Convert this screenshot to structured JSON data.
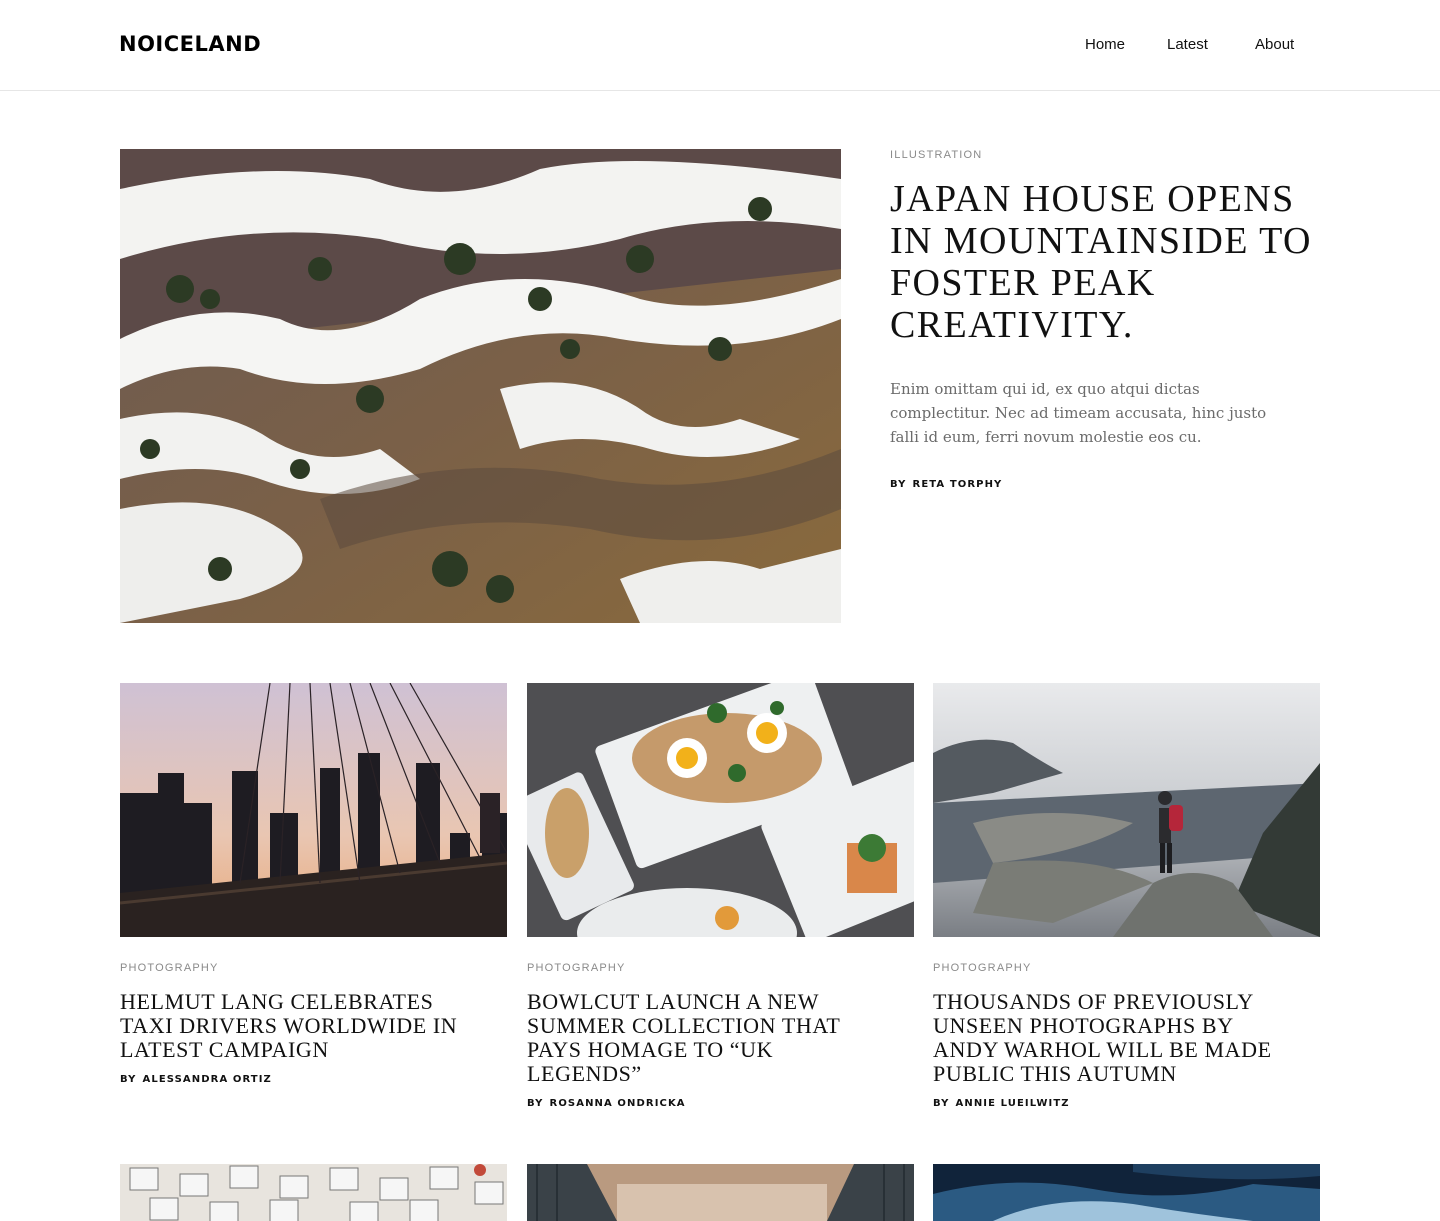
{
  "site": {
    "logo": "NOICELAND"
  },
  "nav": {
    "items": [
      "Home",
      "Latest",
      "About"
    ]
  },
  "hero": {
    "image": "mountain-snow-landscape",
    "category": "ILLUSTRATION",
    "title": "JAPAN HOUSE OPENS IN MOUNTAINSIDE TO FOSTER PEAK CREATIVITY.",
    "excerpt": "Enim omittam qui id, ex quo atqui dictas complectitur. Nec ad timeam accusata, hinc justo falli id eum, ferri novum molestie eos cu.",
    "by": "BY",
    "author": "RETA TORPHY"
  },
  "cards": [
    {
      "image": "city-bridge-sunset",
      "category": "PHOTOGRAPHY",
      "title": "HELMUT LANG CELEBRATES TAXI DRIVERS WORLDWIDE IN LATEST CAMPAIGN",
      "by": "BY",
      "author": "ALESSANDRA ORTIZ"
    },
    {
      "image": "food-plates-table",
      "category": "PHOTOGRAPHY",
      "title": "BOWLCUT LAUNCH A NEW SUMMER COLLECTION THAT PAYS HOMAGE TO “UK LEGENDS”",
      "by": "BY",
      "author": "ROSANNA ONDRICKA"
    },
    {
      "image": "hiker-fjord-view",
      "category": "PHOTOGRAPHY",
      "title": "THOUSANDS OF PREVIOUSLY UNSEEN PHOTOGRAPHS BY ANDY WARHOL WILL BE MADE PUBLIC THIS AUTUMN",
      "by": "BY",
      "author": "ANNIE LUEILWITZ"
    }
  ],
  "more": [
    {
      "image": "beach-chairs-aerial"
    },
    {
      "image": "corridor-interior"
    },
    {
      "image": "blue-ice-mountain"
    }
  ]
}
